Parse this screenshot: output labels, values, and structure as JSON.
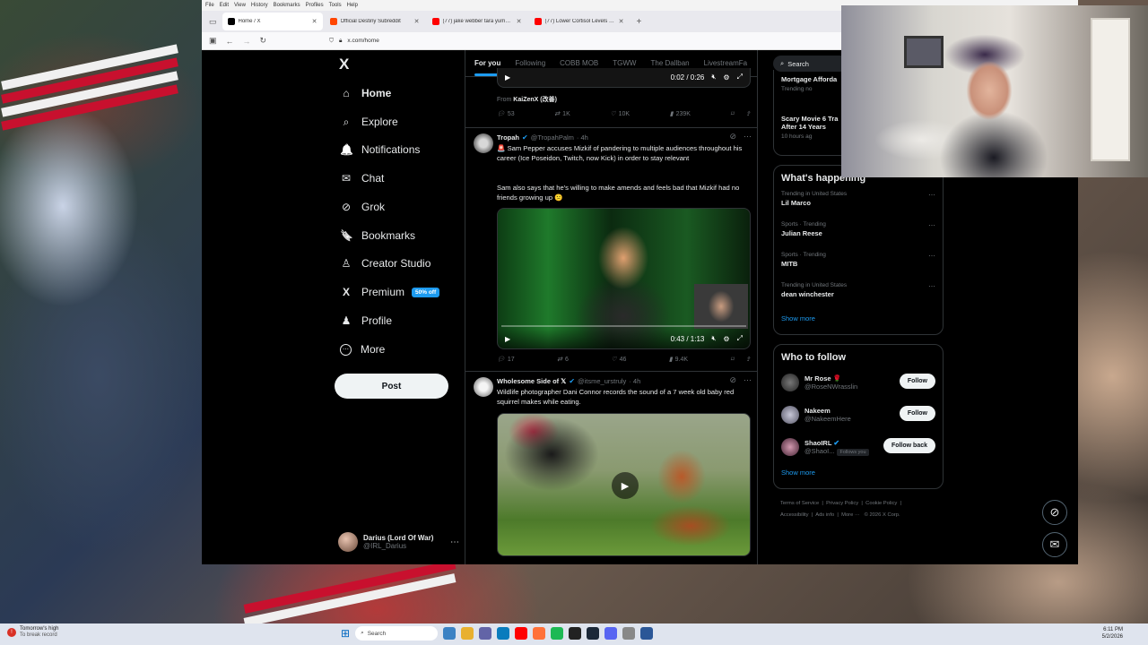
{
  "browser": {
    "menu": [
      "File",
      "Edit",
      "View",
      "History",
      "Bookmarks",
      "Profiles",
      "Tools",
      "Help"
    ],
    "tabs": [
      {
        "title": "Home / X",
        "color": "#000000"
      },
      {
        "title": "Official Destiny Subreddit",
        "color": "#ff4500"
      },
      {
        "title": "(77) jake webber tara yummy n",
        "color": "#ff0000"
      },
      {
        "title": "(77) Lower Cortisol Levels with",
        "color": "#ff0000"
      }
    ],
    "url": "x.com/home"
  },
  "sidebar": {
    "logo": "X",
    "items": [
      {
        "label": "Home",
        "icon": "home-icon",
        "glyph": "⌂"
      },
      {
        "label": "Explore",
        "icon": "search-icon",
        "glyph": "⌕"
      },
      {
        "label": "Notifications",
        "icon": "bell-icon",
        "glyph": "🔔"
      },
      {
        "label": "Chat",
        "icon": "mail-icon",
        "glyph": "✉"
      },
      {
        "label": "Grok",
        "icon": "grok-icon",
        "glyph": "⊘"
      },
      {
        "label": "Bookmarks",
        "icon": "bookmark-icon",
        "glyph": "🔖"
      },
      {
        "label": "Creator Studio",
        "icon": "creator-icon",
        "glyph": "♙"
      },
      {
        "label": "Premium",
        "icon": "x-icon",
        "glyph": "X",
        "badge": "50% off"
      },
      {
        "label": "Profile",
        "icon": "profile-icon",
        "glyph": "♟"
      },
      {
        "label": "More",
        "icon": "more-icon",
        "glyph": "⋯"
      }
    ],
    "post_button": "Post",
    "account": {
      "name": "Darius (Lord Of War)",
      "handle": "@IRL_Darius"
    }
  },
  "feed": {
    "tabs": [
      "For you",
      "Following",
      "COBB MOB",
      "TGWW",
      "The Dallban",
      "LivestreamFa"
    ],
    "post0": {
      "time": "0:02 / 0:26",
      "from_prefix": "From",
      "from": "KaiZenX (改善)",
      "replies": "53",
      "reposts": "1K",
      "likes": "10K",
      "views": "239K"
    },
    "post1": {
      "name": "Tropah",
      "handle": "@TropahPalm",
      "age": "· 4h",
      "text1": "🚨 Sam Pepper accuses Mizkif of pandering to multiple audiences throughout his career (Ice Poseidon, Twitch, now Kick) in order to stay relevant",
      "text2": "Sam also says that he's willing to make amends and feels bad that Mizkif had no friends growing up 😕",
      "time": "0:43 / 1:13",
      "replies": "17",
      "reposts": "6",
      "likes": "46",
      "views": "9.4K"
    },
    "post2": {
      "name": "Wholesome Side of 𝕏",
      "handle": "@itsme_urstruly",
      "age": "· 4h",
      "text": "Wildlife photographer Dani Connor records the sound of a 7 week old baby red squirrel makes while eating."
    }
  },
  "right": {
    "search_placeholder": "Search",
    "partial_trends": [
      {
        "title": "Mortgage Afforda",
        "sub": "Trending no"
      },
      {
        "title": "Scary Movie 6 Tra",
        "title2": "After 14 Years",
        "sub": "10 hours ag"
      }
    ],
    "happening_title": "What's happening",
    "trends": [
      {
        "context": "Trending in United States",
        "title": "Lil Marco"
      },
      {
        "context": "Sports · Trending",
        "title": "Julian Reese"
      },
      {
        "context": "Sports · Trending",
        "title": "MITB"
      },
      {
        "context": "Trending in United States",
        "title": "dean winchester"
      }
    ],
    "show_more": "Show more",
    "wtf_title": "Who to follow",
    "follow": [
      {
        "name": "Mr Rose 🌹",
        "handle": "@RoseNWrasslin",
        "button": "Follow"
      },
      {
        "name": "Nakeem",
        "handle": "@NakeemHere",
        "button": "Follow"
      },
      {
        "name": "ShaoIRL",
        "handle": "@ShaoI...",
        "badge": "Follows you",
        "button": "Follow back"
      }
    ],
    "footer": [
      "Terms of Service",
      "Privacy Policy",
      "Cookie Policy",
      "Accessibility",
      "Ads info",
      "More ···",
      "© 2026 X Corp."
    ]
  },
  "taskbar": {
    "weather_line1": "Tomorrow's high",
    "weather_line2": "To break record",
    "search": "Search",
    "time": "6:11 PM",
    "date": "5/2/2026"
  },
  "colors": {
    "accent": "#1d9bf0",
    "bg": "#000000",
    "muted": "#71767b"
  }
}
